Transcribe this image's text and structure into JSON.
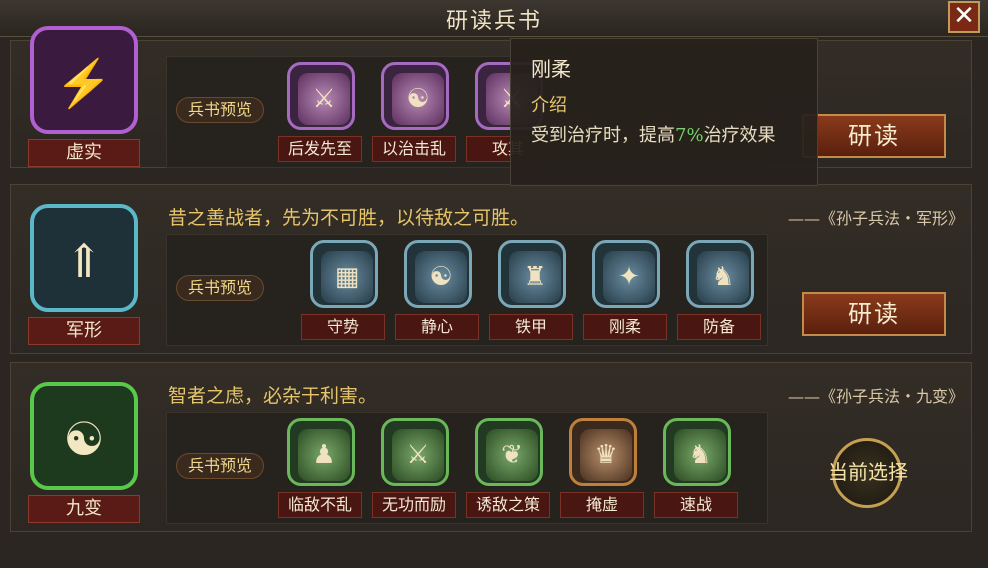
{
  "window": {
    "title": "研读兵书",
    "close_label": "✕"
  },
  "colors": {
    "accent_gold": "#e6c56a",
    "highlight_green": "#7ad06a",
    "button_red": "#8a3a1a"
  },
  "preview_label": "兵书预览",
  "books": [
    {
      "name": "虚实",
      "emblem_icon": "purple-lightning-icon",
      "skills": [
        {
          "name": "后发先至",
          "icon": "spear-warrior-icon"
        },
        {
          "name": "以治击乱",
          "icon": "dancer-icon"
        },
        {
          "name": "攻其",
          "icon": "attacker-icon"
        }
      ],
      "action": "研读"
    },
    {
      "name": "军形",
      "emblem_icon": "blue-arrows-icon",
      "quote": "昔之善战者，先为不可胜，以待敌之可胜。",
      "source": "——《孙子兵法・军形》",
      "skills": [
        {
          "name": "守势",
          "icon": "shield-blocks-icon"
        },
        {
          "name": "静心",
          "icon": "meditating-figure-icon"
        },
        {
          "name": "铁甲",
          "icon": "armor-icon"
        },
        {
          "name": "刚柔",
          "icon": "martial-stance-icon"
        },
        {
          "name": "防备",
          "icon": "guard-figure-icon"
        }
      ],
      "action": "研读"
    },
    {
      "name": "九变",
      "emblem_icon": "yin-yang-icon",
      "quote": "智者之虑，必杂于利害。",
      "source": "——《孙子兵法・九变》",
      "skills": [
        {
          "name": "临敌不乱",
          "icon": "calm-warrior-icon"
        },
        {
          "name": "无功而励",
          "icon": "raised-sword-icon"
        },
        {
          "name": "诱敌之策",
          "icon": "lure-grass-icon"
        },
        {
          "name": "掩虚",
          "icon": "hidden-figure-icon"
        },
        {
          "name": "速战",
          "icon": "charging-warrior-icon"
        }
      ],
      "action": "当前选择"
    }
  ],
  "tooltip": {
    "title": "刚柔",
    "heading": "介绍",
    "desc_before": "受到治疗时，提高",
    "desc_value": "7%",
    "desc_after": "治疗效果"
  }
}
